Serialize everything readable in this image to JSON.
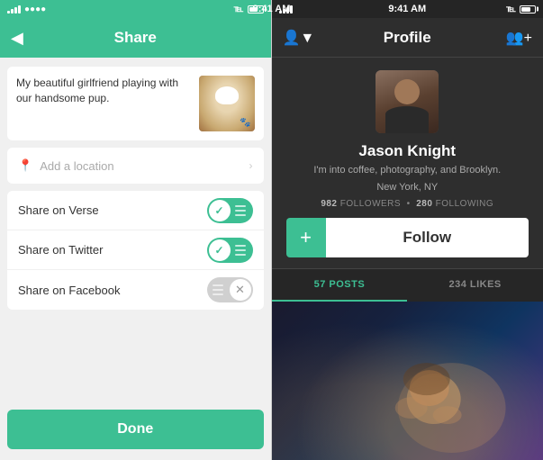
{
  "left": {
    "status": {
      "time": "9:41 AM",
      "signal": "●●●●",
      "wifi": "wifi",
      "battery": "bt"
    },
    "title": "Share",
    "post_text": "My beautiful girlfriend playing with our handsome pup.",
    "location_placeholder": "Add a location",
    "share_options": [
      {
        "label": "Share on Verse",
        "state": "on"
      },
      {
        "label": "Share on Twitter",
        "state": "on"
      },
      {
        "label": "Share on Facebook",
        "state": "off"
      }
    ],
    "done_label": "Done"
  },
  "right": {
    "status": {
      "time": "9:41 AM"
    },
    "title": "Profile",
    "user": {
      "name": "Jason Knight",
      "bio": "I'm into coffee, photography, and Brooklyn.",
      "location": "New York, NY",
      "followers": "982",
      "followers_label": "FOLLOWERS",
      "following": "280",
      "following_label": "FOLLOWING"
    },
    "follow_plus": "+",
    "follow_label": "Follow",
    "tabs": [
      {
        "label": "57 POSTS",
        "active": true
      },
      {
        "label": "234 LIKES",
        "active": false
      }
    ]
  }
}
